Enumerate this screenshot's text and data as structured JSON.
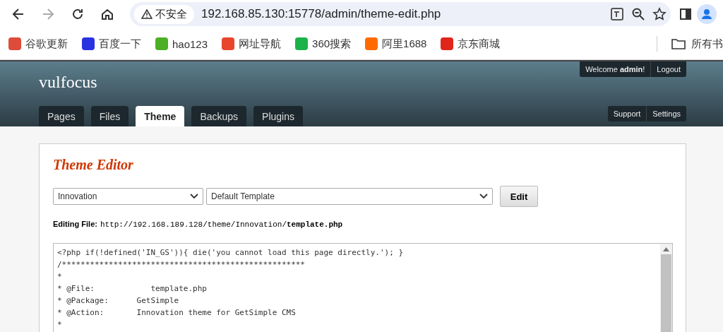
{
  "browser": {
    "security_label": "不安全",
    "url": "192.168.85.130:15778/admin/theme-edit.php"
  },
  "bookmarks": [
    {
      "label": "谷歌更新",
      "color": "#dd4b39"
    },
    {
      "label": "百度一下",
      "color": "#2932e1"
    },
    {
      "label": "hao123",
      "color": "#4caf24"
    },
    {
      "label": "网址导航",
      "color": "#e8452c"
    },
    {
      "label": "360搜索",
      "color": "#1cb24b"
    },
    {
      "label": "阿里1688",
      "color": "#ff6a00"
    },
    {
      "label": "京东商城",
      "color": "#e1251b"
    }
  ],
  "bookmarks_folder": "所有书",
  "site": {
    "title": "vulfocus",
    "welcome": "Welcome **admin**!",
    "logout": "Logout"
  },
  "tabs": [
    {
      "label": "Pages",
      "selected": false
    },
    {
      "label": "Files",
      "selected": false
    },
    {
      "label": "Theme",
      "selected": true
    },
    {
      "label": "Backups",
      "selected": false
    },
    {
      "label": "Plugins",
      "selected": false
    }
  ],
  "side_links": [
    "Support",
    "Settings"
  ],
  "editor": {
    "heading": "Theme Editor",
    "theme_select": "Innovation",
    "template_select": "Default Template",
    "edit_button": "Edit",
    "editing_label": "Editing File:",
    "editing_path": "http://192.168.189.128/theme/Innovation/**template.php**",
    "code_lines": [
      "<?php if(!defined('IN_GS')){ die('you cannot load this page directly.'); }",
      "/****************************************************",
      "*",
      "* @File:            template.php",
      "* @Package:      GetSimple",
      "* @Action:       Innovation theme for GetSimple CMS",
      "*"
    ]
  }
}
